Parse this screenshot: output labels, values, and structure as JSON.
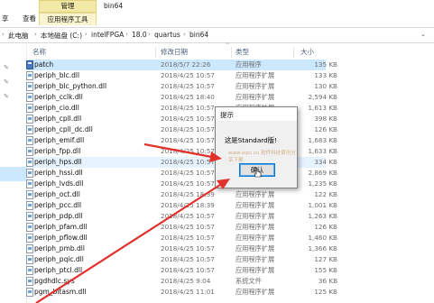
{
  "window": {
    "title": "bin64"
  },
  "ribbon": {
    "tabs": [
      "享",
      "查看"
    ],
    "manage": "管理",
    "app_tools": "应用程序工具"
  },
  "address": {
    "crumbs": [
      "此电脑",
      "本地磁盘 (C:)",
      "intelFPGA",
      "18.0",
      "quartus",
      "bin64"
    ]
  },
  "columns": {
    "name": "名称",
    "date": "修改日期",
    "type": "类型",
    "size": "大小"
  },
  "files": [
    {
      "name": "patch",
      "date": "2018/5/7 22:26",
      "type": "应用程序",
      "size": "135 KB",
      "icon": "exe-icon"
    },
    {
      "name": "periph_blc.dll",
      "date": "2018/4/25 10:57",
      "type": "应用程序扩展",
      "size": "133 KB",
      "icon": "dll-icon"
    },
    {
      "name": "periph_blc_python.dll",
      "date": "2018/4/25 10:57",
      "type": "应用程序扩展",
      "size": "130 KB",
      "icon": "dll-icon"
    },
    {
      "name": "periph_cclk.dll",
      "date": "2018/4/25 18:40",
      "type": "应用程序扩展",
      "size": "2,594 KB",
      "icon": "dll-icon"
    },
    {
      "name": "periph_cio.dll",
      "date": "2018/4/25 10:57",
      "type": "应用程序扩展",
      "size": "1,613 KB",
      "icon": "dll-icon"
    },
    {
      "name": "periph_cpll.dll",
      "date": "2018/4/25 10:57",
      "type": "应用程序扩展",
      "size": "398 KB",
      "icon": "dll-icon"
    },
    {
      "name": "periph_cpll_dc.dll",
      "date": "2018/4/25 10:57",
      "type": "应用程序扩展",
      "size": "126 KB",
      "icon": "dll-icon"
    },
    {
      "name": "periph_emif.dll",
      "date": "2018/4/25 10:57",
      "type": "应用程序扩展",
      "size": "1,683 KB",
      "icon": "dll-icon"
    },
    {
      "name": "periph_fpp.dll",
      "date": "2018/4/25 10:57",
      "type": "应用程序扩展",
      "size": "1,633 KB",
      "icon": "dll-icon"
    },
    {
      "name": "periph_hps.dll",
      "date": "2018/4/25 10:57",
      "type": "应用程序扩展",
      "size": "334 KB",
      "icon": "dll-icon"
    },
    {
      "name": "periph_hssi.dll",
      "date": "2018/4/25 10:57",
      "type": "应用程序扩展",
      "size": "2,869 KB",
      "icon": "dll-icon"
    },
    {
      "name": "periph_lvds.dll",
      "date": "2018/4/25 10:57",
      "type": "应用程序扩展",
      "size": "1,235 KB",
      "icon": "dll-icon"
    },
    {
      "name": "periph_oct.dll",
      "date": "2018/4/25 18:39",
      "type": "应用程序扩展",
      "size": "122 KB",
      "icon": "dll-icon"
    },
    {
      "name": "periph_pcc.dll",
      "date": "2018/4/25 18:39",
      "type": "应用程序扩展",
      "size": "1,001 KB",
      "icon": "dll-icon"
    },
    {
      "name": "periph_pdp.dll",
      "date": "2018/4/25 10:57",
      "type": "应用程序扩展",
      "size": "1,263 KB",
      "icon": "dll-icon"
    },
    {
      "name": "periph_pfam.dll",
      "date": "2018/4/25 10:57",
      "type": "应用程序扩展",
      "size": "126 KB",
      "icon": "dll-icon"
    },
    {
      "name": "periph_pflow.dll",
      "date": "2018/4/25 10:57",
      "type": "应用程序扩展",
      "size": "1,460 KB",
      "icon": "dll-icon"
    },
    {
      "name": "periph_pmb.dll",
      "date": "2018/4/25 10:57",
      "type": "应用程序扩展",
      "size": "1,366 KB",
      "icon": "dll-icon"
    },
    {
      "name": "periph_pqic.dll",
      "date": "2018/4/25 10:57",
      "type": "应用程序扩展",
      "size": "127 KB",
      "icon": "dll-icon"
    },
    {
      "name": "periph_ptcl.dll",
      "date": "2018/4/25 10:57",
      "type": "应用程序扩展",
      "size": "155 KB",
      "icon": "dll-icon"
    },
    {
      "name": "pgdhdlc.sys",
      "date": "2018/4/25 9:04",
      "type": "系统文件",
      "size": "36 KB",
      "icon": "sys-icon"
    },
    {
      "name": "pgm_bitasm.dll",
      "date": "2018/4/25 11:01",
      "type": "应用程序扩展",
      "size": "125 KB",
      "icon": "dll-icon"
    }
  ],
  "dialog": {
    "title": "提示",
    "message": "这是Standard版!",
    "watermark": "www.aipc.cn 软件科技资讯分享下载",
    "ok_label": "确认"
  },
  "colors": {
    "selection": "#cce8ff",
    "manage_tab": "#f3e9a6",
    "arrow": "#e0312b"
  }
}
